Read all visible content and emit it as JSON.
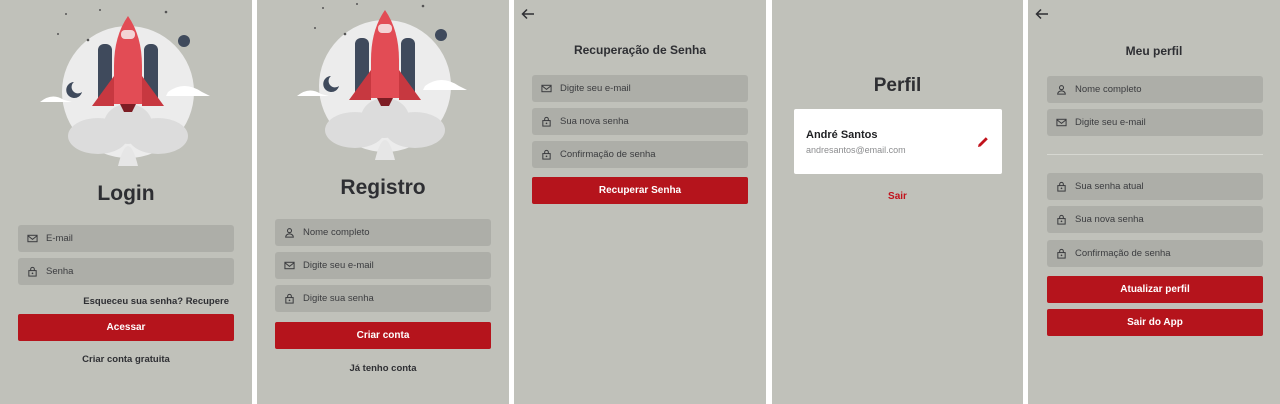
{
  "login": {
    "title": "Login",
    "email_placeholder": "E-mail",
    "password_placeholder": "Senha",
    "forgot_link": "Esqueceu sua senha? Recupere",
    "submit_button": "Acessar",
    "create_account_link": "Criar conta gratuita"
  },
  "register": {
    "title": "Registro",
    "name_placeholder": "Nome completo",
    "email_placeholder": "Digite seu e-mail",
    "password_placeholder": "Digite sua senha",
    "submit_button": "Criar conta",
    "have_account_link": "Já tenho conta"
  },
  "recovery": {
    "title": "Recuperação de Senha",
    "email_placeholder": "Digite seu e-mail",
    "new_password_placeholder": "Sua nova senha",
    "confirm_password_placeholder": "Confirmação de senha",
    "submit_button": "Recuperar Senha"
  },
  "profile": {
    "title": "Perfil",
    "user_name": "André Santos",
    "user_email": "andresantos@email.com",
    "logout_link": "Sair"
  },
  "my_profile": {
    "title": "Meu perfil",
    "name_placeholder": "Nome completo",
    "email_placeholder": "Digite seu e-mail",
    "current_password_placeholder": "Sua senha atual",
    "new_password_placeholder": "Sua nova senha",
    "confirm_password_placeholder": "Confirmação de senha",
    "update_button": "Atualizar perfil",
    "exit_app_button": "Sair do App"
  },
  "colors": {
    "background": "#c0c1ba",
    "field": "#adaea8",
    "primary": "#b5141c",
    "text": "#2e2f33"
  },
  "icons": {
    "email": "envelope-icon",
    "password": "lock-icon",
    "name": "person-icon",
    "back": "arrow-left-icon",
    "edit": "pencil-icon",
    "illustration": "rocket-illustration"
  }
}
